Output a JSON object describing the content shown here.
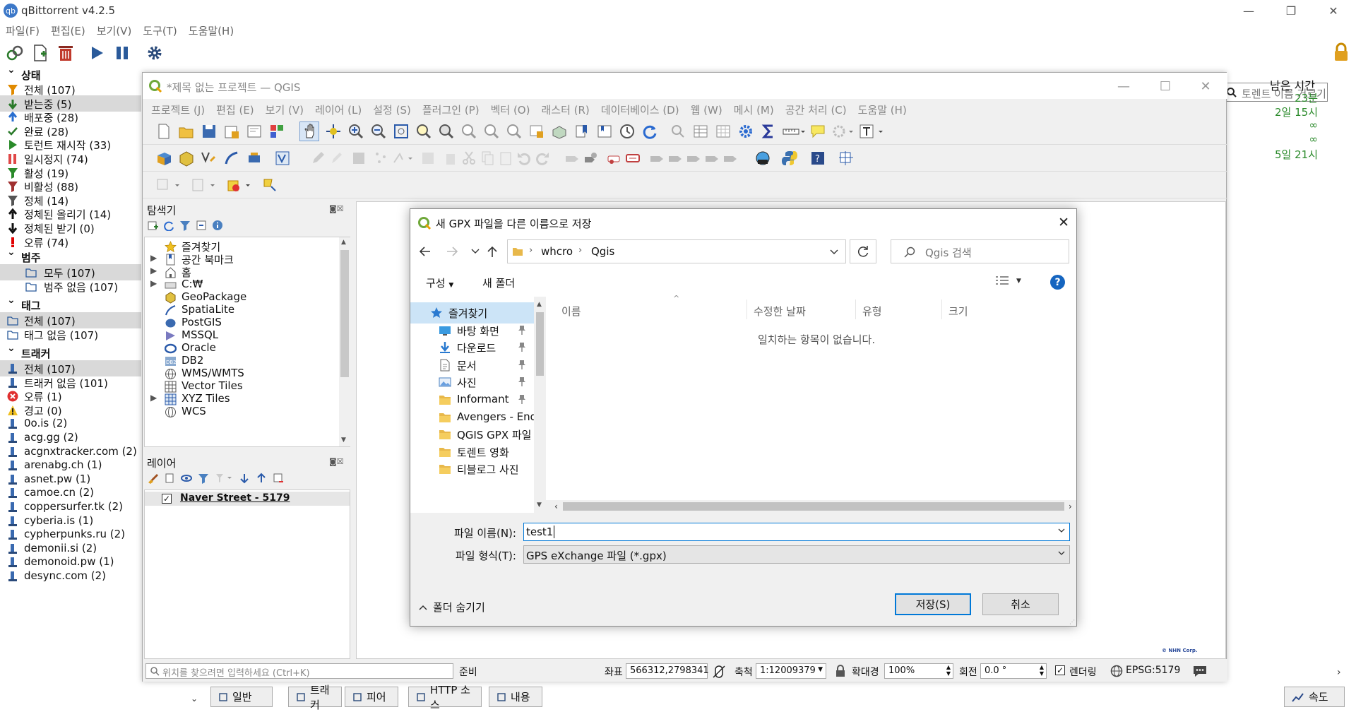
{
  "qb": {
    "title": "qBittorrent v4.2.5",
    "menu": [
      "파일(F)",
      "편집(E)",
      "보기(V)",
      "도구(T)",
      "도움말(H)"
    ],
    "search_placeholder": "토렌트 이름 거르기...",
    "status_header": "상태",
    "status_items": [
      {
        "label": "전체 (107)",
        "color": "#e08a00"
      },
      {
        "label": "받는중 (5)",
        "color": "#2a7a2a"
      },
      {
        "label": "배포중 (28)",
        "color": "#2a6fd0"
      },
      {
        "label": "완료 (28)",
        "color": "#2a7a2a"
      },
      {
        "label": "토런트 재시작 (33)",
        "color": "#2a8a2a"
      },
      {
        "label": "일시정지 (74)",
        "color": "#e04848"
      },
      {
        "label": "활성 (19)",
        "color": "#2a8a2a"
      },
      {
        "label": "비활성 (88)",
        "color": "#a03030"
      },
      {
        "label": "정체 (14)",
        "color": "#555555"
      },
      {
        "label": "정체된 올리기 (14)",
        "color": "#111111"
      },
      {
        "label": "정체된 받기 (0)",
        "color": "#111111"
      },
      {
        "label": "오류 (74)",
        "color": "#e00000"
      }
    ],
    "category_header": "범주",
    "category_items": [
      "모두 (107)",
      "범주 없음 (107)"
    ],
    "tag_header": "태그",
    "tag_items": [
      "전체 (107)",
      "태그 없음 (107)"
    ],
    "tracker_header": "트래커",
    "tracker_items": [
      "전체 (107)",
      "트래커 없음 (101)",
      "오류 (1)",
      "경고 (0)",
      "0o.is (2)",
      "acg.gg (2)",
      "acgnxtracker.com (2)",
      "arenabg.ch (1)",
      "asnet.pw (1)",
      "camoe.cn (2)",
      "coppersurfer.tk (2)",
      "cyberia.is (1)",
      "cypherpunks.ru (2)",
      "demonii.si (2)",
      "demonoid.pw (1)",
      "desync.com (2)"
    ],
    "right_header": "남은 시간",
    "right_values": [
      "23분",
      "2일 15시",
      "∞",
      "∞",
      "5일 21시"
    ],
    "bottom_tabs": [
      "일반",
      "트래커",
      "피어",
      "HTTP 소스",
      "내용"
    ],
    "speed_label": "속도"
  },
  "qgis": {
    "title": "*제목 없는 프로젝트 — QGIS",
    "menu": [
      "프로젝트 (J)",
      "편집 (E)",
      "보기 (V)",
      "레이어 (L)",
      "설정 (S)",
      "플러그인 (P)",
      "벡터 (O)",
      "래스터 (R)",
      "데이터베이스 (D)",
      "웹 (W)",
      "메시 (M)",
      "공간 처리 (C)",
      "도움말 (H)"
    ],
    "browser_title": "탐색기",
    "browser_items": [
      {
        "label": "즐겨찾기",
        "expand": ""
      },
      {
        "label": "공간 북마크",
        "expand": "▶"
      },
      {
        "label": "홈",
        "expand": "▶"
      },
      {
        "label": "C:₩",
        "expand": "▶"
      },
      {
        "label": "GeoPackage",
        "expand": ""
      },
      {
        "label": "SpatiaLite",
        "expand": ""
      },
      {
        "label": "PostGIS",
        "expand": ""
      },
      {
        "label": "MSSQL",
        "expand": ""
      },
      {
        "label": "Oracle",
        "expand": ""
      },
      {
        "label": "DB2",
        "expand": ""
      },
      {
        "label": "WMS/WMTS",
        "expand": ""
      },
      {
        "label": "Vector Tiles",
        "expand": ""
      },
      {
        "label": "XYZ Tiles",
        "expand": "▶"
      },
      {
        "label": "WCS",
        "expand": ""
      }
    ],
    "layers_title": "레이어",
    "layer_name": "Naver Street - 5179",
    "locate_placeholder": "위치를 찾으려면 입력하세요 (Ctrl+K)",
    "status": {
      "ready": "준비",
      "coord_label": "좌표",
      "coord_value": "566312,2798341",
      "scale_label": "축척",
      "scale_value": "1:12009379",
      "magnifier_label": "확대경",
      "magnifier_value": "100%",
      "rotation_label": "회전",
      "rotation_value": "0.0 °",
      "render_label": "렌더링",
      "crs": "EPSG:5179"
    },
    "copyright": "© NHN Corp."
  },
  "dialog": {
    "title": "새 GPX 파일을 다른 이름으로 저장",
    "path": [
      "whcro",
      "Qgis"
    ],
    "search_placeholder": "Qgis 검색",
    "organize": "구성",
    "new_folder": "새 폴더",
    "nav_items": [
      {
        "label": "즐겨찾기",
        "pinned": false,
        "icon": "star-icon"
      },
      {
        "label": "바탕 화면",
        "pinned": true,
        "icon": "desktop-icon"
      },
      {
        "label": "다운로드",
        "pinned": true,
        "icon": "download-icon"
      },
      {
        "label": "문서",
        "pinned": true,
        "icon": "document-icon"
      },
      {
        "label": "사진",
        "pinned": true,
        "icon": "picture-icon"
      },
      {
        "label": "Informant",
        "pinned": true,
        "icon": "folder-icon"
      },
      {
        "label": "Avengers - Endgame",
        "pinned": false,
        "icon": "folder-icon"
      },
      {
        "label": "QGIS GPX 파일",
        "pinned": false,
        "icon": "folder-icon"
      },
      {
        "label": "토렌트 영화",
        "pinned": false,
        "icon": "folder-icon"
      },
      {
        "label": "티블로그 사진",
        "pinned": false,
        "icon": "folder-icon"
      }
    ],
    "columns": [
      "이름",
      "수정한 날짜",
      "유형",
      "크기"
    ],
    "empty_message": "일치하는 항목이 없습니다.",
    "filename_label": "파일 이름(N):",
    "filename_value": "test1",
    "filetype_label": "파일 형식(T):",
    "filetype_value": "GPS eXchange 파일 (*.gpx)",
    "hide_folders": "폴더 숨기기",
    "save_button": "저장(S)",
    "cancel_button": "취소"
  }
}
